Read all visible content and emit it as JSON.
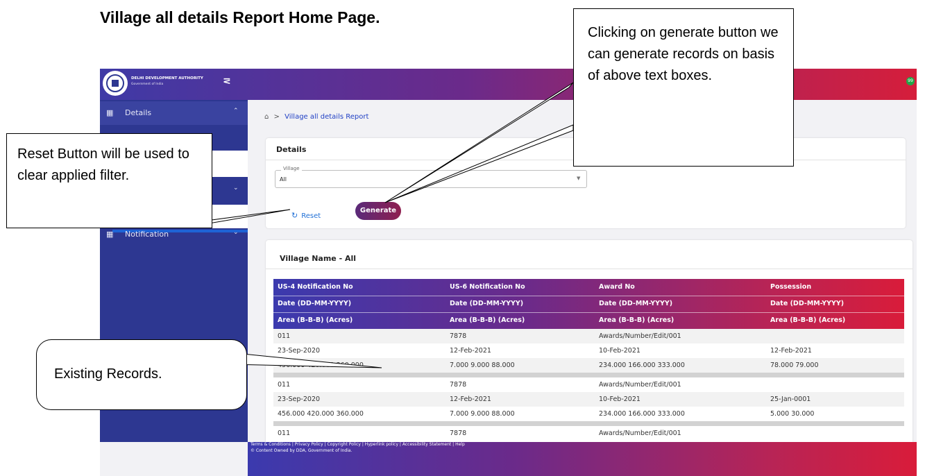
{
  "doc_title": "Village all details Report Home Page.",
  "header": {
    "org_name": "DELHI DEVELOPMENT AUTHORITY",
    "org_sub": "Government of India",
    "menu_toggle": "⋜",
    "notification_count": "99"
  },
  "sidebar": {
    "items": [
      {
        "icon": "▦",
        "label": "Details",
        "chevron": "⌃"
      },
      {
        "icon": "▦",
        "label": "Notification",
        "chevron": "⌄"
      }
    ],
    "collapsed_chevron": "⌄"
  },
  "breadcrumb": {
    "home": "⌂",
    "sep": ">",
    "current": "Village all details Report"
  },
  "filter_card": {
    "title": "Details",
    "village_label": "Village",
    "village_value": "All",
    "reset_label": "Reset",
    "generate_label": "Generate"
  },
  "results": {
    "title": "Village Name - All",
    "headers": [
      [
        "US-4 Notification No",
        "US-6 Notification No",
        "Award No",
        "Possession"
      ],
      [
        "Date (DD-MM-YYYY)",
        "Date (DD-MM-YYYY)",
        "Date (DD-MM-YYYY)",
        "Date (DD-MM-YYYY)"
      ],
      [
        "Area (B-B-B) (Acres)",
        "Area (B-B-B) (Acres)",
        "Area (B-B-B) (Acres)",
        "Area (B-B-B) (Acres)"
      ]
    ],
    "records": [
      [
        [
          "011",
          "7878",
          "Awards/Number/Edit/001",
          ""
        ],
        [
          "23-Sep-2020",
          "12-Feb-2021",
          "10-Feb-2021",
          "12-Feb-2021"
        ],
        [
          "456.000 420.000 360.000",
          "7.000 9.000 88.000",
          "234.000 166.000 333.000",
          "78.000 79.000"
        ]
      ],
      [
        [
          "011",
          "7878",
          "Awards/Number/Edit/001",
          ""
        ],
        [
          "23-Sep-2020",
          "12-Feb-2021",
          "10-Feb-2021",
          "25-Jan-0001"
        ],
        [
          "456.000 420.000 360.000",
          "7.000 9.000 88.000",
          "234.000 166.000 333.000",
          "5.000 30.000"
        ]
      ],
      [
        [
          "011",
          "7878",
          "Awards/Number/Edit/001",
          ""
        ]
      ]
    ]
  },
  "footer": {
    "links": "Terms & Conditions | Privacy Policy | Copyright Policy | Hyperlink policy | Accessibility Statement | Help",
    "copyright": "© Content Owned by DDA, Government of India."
  },
  "callouts": {
    "generate": "Clicking on generate button we can generate records on basis of above text boxes.",
    "reset": "Reset Button will be used to clear applied filter.",
    "existing": "Existing Records."
  },
  "colors": {
    "sidebar": "#2d3791",
    "gradient_start": "#3b3aae",
    "gradient_end": "#d91c3a",
    "link_blue": "#1f6fd6"
  }
}
